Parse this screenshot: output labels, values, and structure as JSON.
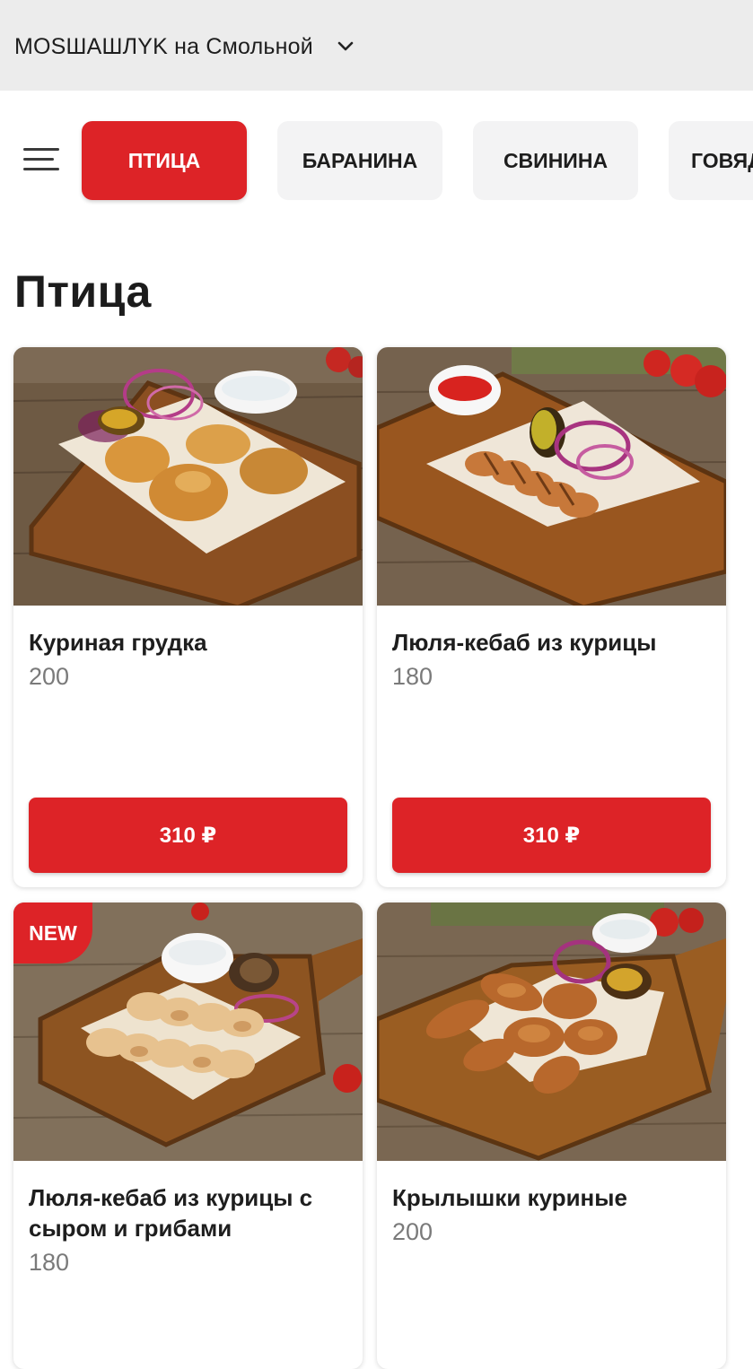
{
  "header": {
    "restaurant": "MOSШАШЛYK на Смольной",
    "chevron_icon": "chevron-down-icon"
  },
  "menu_icon": "hamburger-menu-icon",
  "categories": [
    {
      "label": "ПТИЦА",
      "active": true
    },
    {
      "label": "БАРАНИНА",
      "active": false
    },
    {
      "label": "СВИНИНА",
      "active": false
    },
    {
      "label": "ГОВЯД",
      "active": false
    }
  ],
  "section_title": "Птица",
  "products": [
    {
      "name": "Куриная грудка",
      "weight": "200",
      "price": "310 ₽",
      "badge": ""
    },
    {
      "name": "Люля-кебаб из курицы",
      "weight": "180",
      "price": "310 ₽",
      "badge": ""
    },
    {
      "name": "Люля-кебаб из курицы с сыром и грибами",
      "weight": "180",
      "price": "",
      "badge": "NEW"
    },
    {
      "name": "Крылышки куриные",
      "weight": "200",
      "price": "",
      "badge": ""
    }
  ],
  "colors": {
    "accent": "#dd2327",
    "header_bg": "#ececec",
    "tab_bg": "#f3f3f4",
    "weight_text": "#7a7a7a"
  }
}
